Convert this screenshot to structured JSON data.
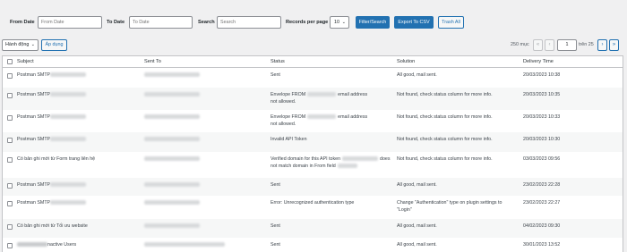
{
  "filters": {
    "from_date_label": "From Date",
    "from_date_placeholder": "From Date",
    "to_date_label": "To Date",
    "to_date_placeholder": "To Date",
    "search_label": "Search",
    "search_placeholder": "Search",
    "records_per_page_label": "Records per page",
    "records_per_page_value": "10",
    "filter_button": "Filter/Search",
    "export_button": "Export To CSV",
    "trash_button": "Trash All"
  },
  "bulk": {
    "action_label": "Hành động",
    "apply_button": "Áp dụng"
  },
  "pagination": {
    "total": "250 mục",
    "first": "«",
    "prev": "‹",
    "current": "1",
    "of_total": "trên 25",
    "next": "›",
    "last": "»"
  },
  "table": {
    "columns": [
      "Subject",
      "Sent To",
      "Status",
      "Solution",
      "Delivery Time"
    ],
    "rows": [
      {
        "subject": "Postman SMTP",
        "status_lines": [
          "Sent"
        ],
        "solution_lines": [
          "All good, mail sent."
        ],
        "time": "20/03/2023 10:38"
      },
      {
        "subject": "Postman SMTP",
        "status_lines": [
          "Envelope FROM",
          "email address",
          "not allowed."
        ],
        "solution_lines": [
          "Not found, check status column for more info."
        ],
        "time": "20/03/2023 10:35"
      },
      {
        "subject": "Postman SMTP",
        "status_lines": [
          "Envelope FROM",
          "email address",
          "not allowed."
        ],
        "solution_lines": [
          "Not found, check status column for more info."
        ],
        "time": "20/03/2023 10:33"
      },
      {
        "subject": "Postman SMTP",
        "status_lines": [
          "Invalid API Token"
        ],
        "solution_lines": [
          "Not found, check status column for more info."
        ],
        "time": "20/03/2023 10:30"
      },
      {
        "subject": "Có bản ghi mới từ Form trang liên hệ",
        "status_lines": [
          "Verified domain for this API token",
          "does",
          "not match domain in From field"
        ],
        "solution_lines": [
          "Not found, check status column for more info."
        ],
        "time": "03/03/2023 09:56"
      },
      {
        "subject": "Postman SMTP",
        "status_lines": [
          "Sent"
        ],
        "solution_lines": [
          "All good, mail sent."
        ],
        "time": "23/02/2023 22:28"
      },
      {
        "subject": "Postman SMTP",
        "status_lines": [
          "Error: Unrecognized authentication type"
        ],
        "solution_lines": [
          "Change \"Authentication\" type on plugin settings to",
          "\"Login\""
        ],
        "time": "23/02/2023 22:27"
      },
      {
        "subject": "Có bản ghi mới từ Tối ưu website",
        "status_lines": [
          "Sent"
        ],
        "solution_lines": [
          "All good, mail sent."
        ],
        "time": "04/02/2023 09:30"
      },
      {
        "subject": "nactive Users",
        "status_lines": [
          "Sent"
        ],
        "solution_lines": [
          "All good, mail sent."
        ],
        "time": "30/01/2023 13:52"
      }
    ]
  }
}
